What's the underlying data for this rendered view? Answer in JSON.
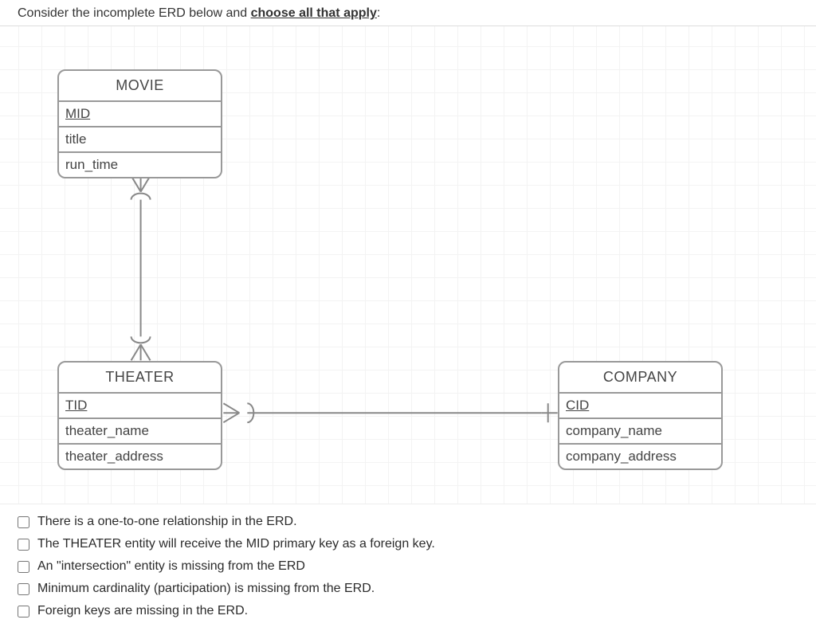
{
  "question": {
    "prefix": "Consider the incomplete ERD below and ",
    "emphasis": "choose all that apply",
    "suffix": ":"
  },
  "entities": {
    "movie": {
      "name": "MOVIE",
      "attrs": {
        "pk": "MID",
        "a1": "title",
        "a2": "run_time"
      }
    },
    "theater": {
      "name": "THEATER",
      "attrs": {
        "pk": "TID",
        "a1": "theater_name",
        "a2": "theater_address"
      }
    },
    "company": {
      "name": "COMPANY",
      "attrs": {
        "pk": "CID",
        "a1": "company_name",
        "a2": "company_address"
      }
    }
  },
  "options": {
    "o1": "There is a one-to-one relationship in the ERD.",
    "o2": "The THEATER entity will receive the MID primary key as a foreign key.",
    "o3": "An \"intersection\" entity is missing from the ERD",
    "o4": "Minimum cardinality (participation) is missing from the ERD.",
    "o5": "Foreign keys are missing in the ERD."
  }
}
